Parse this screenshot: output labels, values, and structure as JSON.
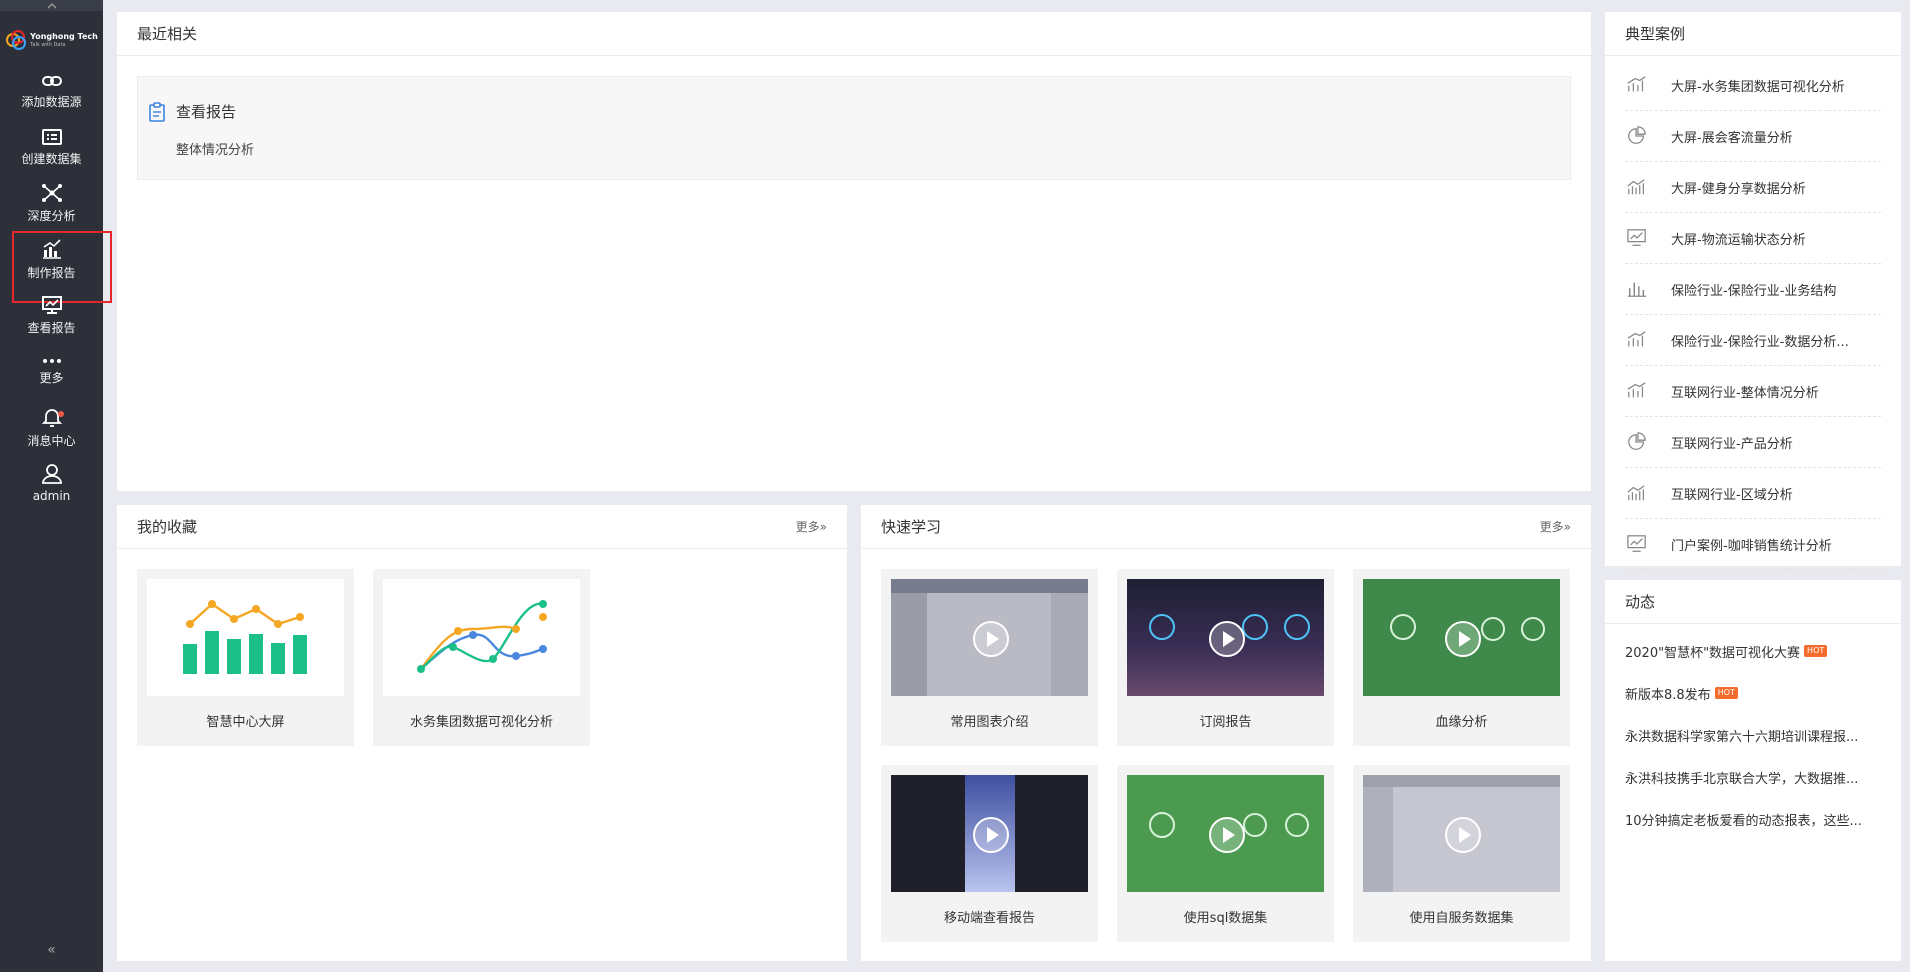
{
  "logo": {
    "name": "Yonghong Tech",
    "tagline": "Talk with Data"
  },
  "nav": {
    "items": [
      {
        "label": "添加数据源",
        "icon": "link-icon"
      },
      {
        "label": "创建数据集",
        "icon": "dataset-icon"
      },
      {
        "label": "深度分析",
        "icon": "network-icon"
      },
      {
        "label": "制作报告",
        "icon": "chart-edit-icon"
      },
      {
        "label": "查看报告",
        "icon": "view-report-icon"
      },
      {
        "label": "更多",
        "icon": "more-icon"
      },
      {
        "label": "消息中心",
        "icon": "bell-icon"
      },
      {
        "label": "admin",
        "icon": "user-icon"
      }
    ],
    "selected": "制作报告",
    "collapse": "«"
  },
  "recent": {
    "title": "最近相关",
    "group_title": "查看报告",
    "items": [
      "整体情况分析"
    ]
  },
  "favorites": {
    "title": "我的收藏",
    "more": "更多»",
    "items": [
      "智慧中心大屏",
      "水务集团数据可视化分析"
    ]
  },
  "learn": {
    "title": "快速学习",
    "more": "更多»",
    "items": [
      "常用图表介绍",
      "订阅报告",
      "血缘分析",
      "移动端查看报告",
      "使用sql数据集",
      "使用自服务数据集"
    ]
  },
  "cases": {
    "title": "典型案例",
    "items": [
      {
        "label": "大屏-水务集团数据可视化分析",
        "icon": "trend-icon"
      },
      {
        "label": "大屏-展会客流量分析",
        "icon": "pie-icon"
      },
      {
        "label": "大屏-健身分享数据分析",
        "icon": "bar-line-icon"
      },
      {
        "label": "大屏-物流运输状态分析",
        "icon": "monitor-chart-icon"
      },
      {
        "label": "保险行业-保险行业-业务结构",
        "icon": "bar-icon"
      },
      {
        "label": "保险行业-保险行业-数据分析...",
        "icon": "trend-icon"
      },
      {
        "label": "互联网行业-整体情况分析",
        "icon": "trend-icon"
      },
      {
        "label": "互联网行业-产品分析",
        "icon": "pie-icon"
      },
      {
        "label": "互联网行业-区域分析",
        "icon": "bar-line-icon"
      },
      {
        "label": "门户案例-咖啡销售统计分析",
        "icon": "monitor-chart-icon"
      }
    ]
  },
  "news": {
    "title": "动态",
    "hot_label": "HOT",
    "items": [
      {
        "label": "2020\"智慧杯\"数据可视化大赛",
        "hot": true
      },
      {
        "label": "新版本8.8发布",
        "hot": true
      },
      {
        "label": "永洪数据科学家第六十六期培训课程报...",
        "hot": false
      },
      {
        "label": "永洪科技携手北京联合大学，大数据推...",
        "hot": false
      },
      {
        "label": "10分钟搞定老板爱看的动态报表，这些...",
        "hot": false
      }
    ]
  },
  "colors": {
    "sidebar": "#2d3039",
    "accent_green": "#1bbf88",
    "accent_orange": "#f5a623",
    "accent_blue": "#4a88e0",
    "selected_border": "#e3272b"
  }
}
